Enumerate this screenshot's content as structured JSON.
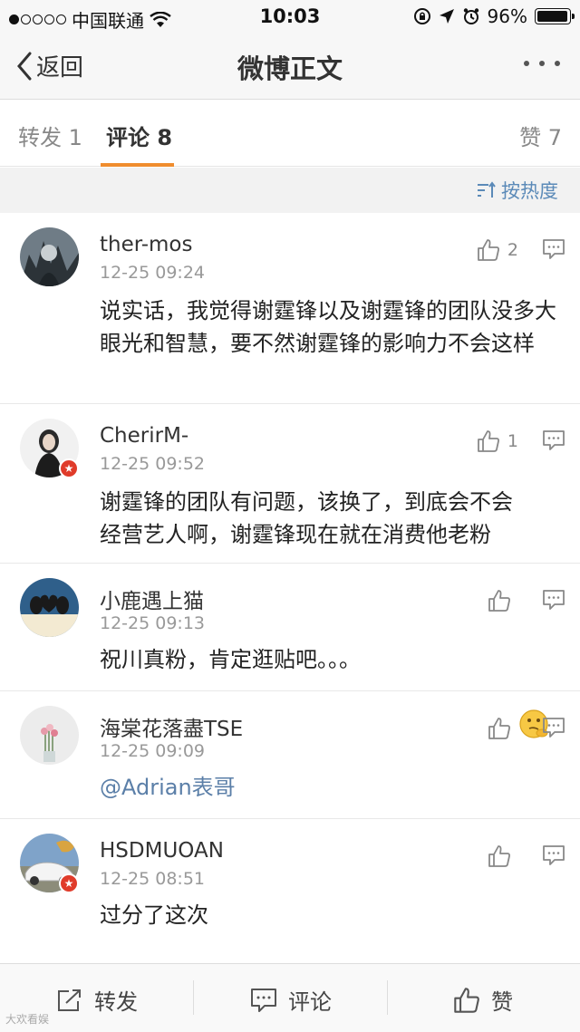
{
  "status_bar": {
    "carrier": "中国联通",
    "time": "10:03",
    "battery": "96%",
    "battery_level": 0.96
  },
  "nav": {
    "back_label": "返回",
    "title": "微博正文"
  },
  "tabs": {
    "repost": "转发 1",
    "comment": "评论 8",
    "like": "赞 7"
  },
  "sort": {
    "label": "按热度"
  },
  "comments": [
    {
      "username": "ther-mos",
      "time": "12-25 09:24",
      "text": "说实话，我觉得谢霆锋以及谢霆锋的团队没多大眼光和智慧，要不然谢霆锋的影响力不会这样",
      "likes": "2"
    },
    {
      "username": "CherirM-",
      "time": "12-25 09:52",
      "text": "谢霆锋的团队有问题，该换了，到底会不会经营艺人啊，谢霆锋现在就在消费他老粉",
      "likes": "1"
    },
    {
      "username": "小鹿遇上猫",
      "time": "12-25 09:13",
      "text": "祝川真粉，肯定逛贴吧。。。",
      "likes": ""
    },
    {
      "username": "海棠花落盡TSE",
      "time": "12-25 09:09",
      "text": "@Adrian表哥",
      "likes": ""
    },
    {
      "username": "HSDMUOAN",
      "time": "12-25 08:51",
      "text": "过分了这次",
      "likes": ""
    }
  ],
  "toolbar": {
    "repost": "转发",
    "comment": "评论",
    "like": "赞"
  },
  "watermark": "大欢看娱",
  "colors": {
    "accent": "#f08d2e",
    "link": "#5b8ab8",
    "badge": "#e03b2a"
  }
}
